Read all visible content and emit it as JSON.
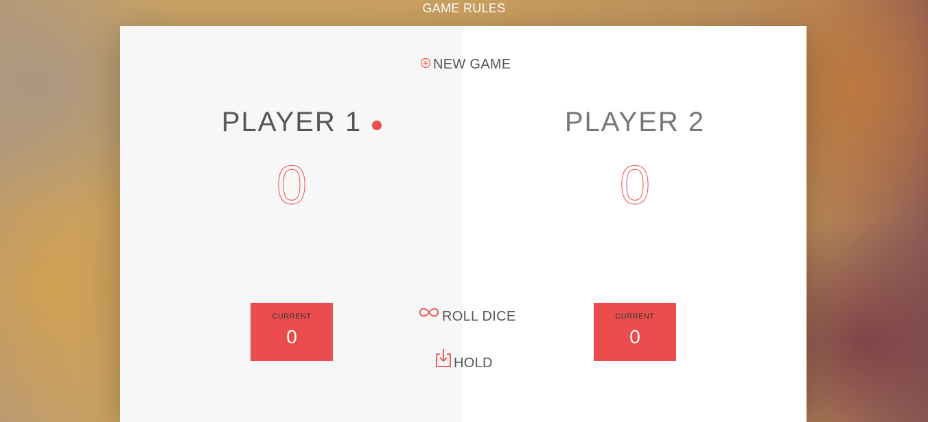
{
  "header": {
    "rules_label": "GAME RULES"
  },
  "controls": {
    "new_game_label": "NEW GAME",
    "roll_dice_label": "ROLL DICE",
    "hold_label": "HOLD"
  },
  "players": [
    {
      "name": "PLAYER 1",
      "score": "0",
      "current_label": "CURRENT",
      "current_score": "0",
      "active": true
    },
    {
      "name": "PLAYER 2",
      "score": "0",
      "current_label": "CURRENT",
      "current_score": "0",
      "active": false
    }
  ],
  "icons": {
    "new_game": "plus-circle-icon",
    "roll_dice": "infinity-icon",
    "hold": "download-icon",
    "active": "active-dot-icon"
  },
  "colors": {
    "accent": "#eb4d4d",
    "panel_active": "#f7f7f7",
    "panel_inactive": "#ffffff",
    "text": "#555555"
  }
}
